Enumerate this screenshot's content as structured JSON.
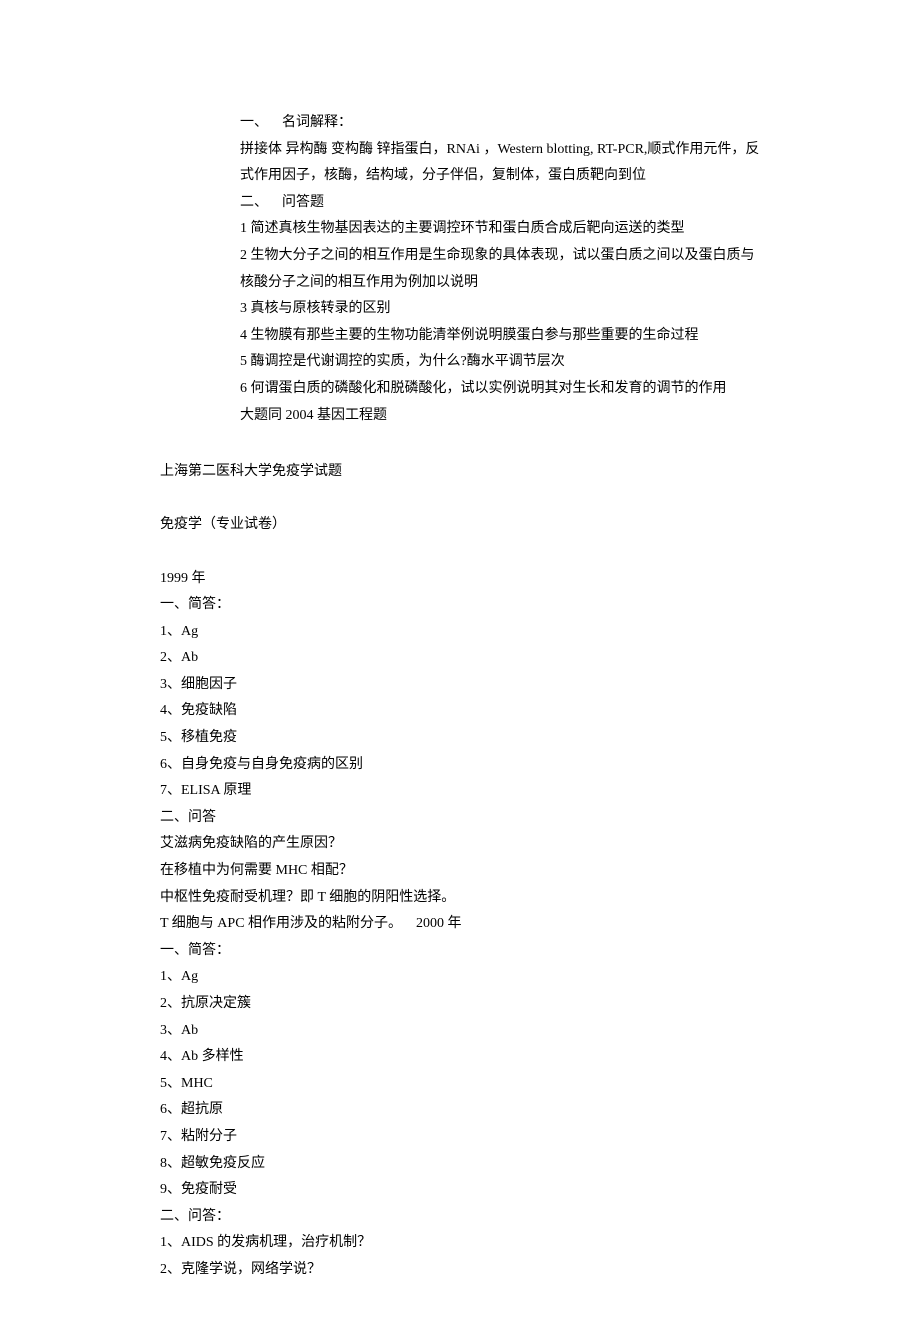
{
  "block1": {
    "s1_title": "一、 名词解释：",
    "s1_terms": "拼接体 异构酶 变构酶 锌指蛋白，RNAi ，Western blotting, RT-PCR,顺式作用元件，反式作用因子，核酶，结构域，分子伴侣，复制体，蛋白质靶向到位",
    "s2_title": "二、 问答题",
    "s2_q1": "1 简述真核生物基因表达的主要调控环节和蛋白质合成后靶向运送的类型",
    "s2_q2": "2 生物大分子之间的相互作用是生命现象的具体表现，试以蛋白质之间以及蛋白质与核酸分子之间的相互作用为例加以说明",
    "s2_q3": "3 真核与原核转录的区别",
    "s2_q4": "4 生物膜有那些主要的生物功能清举例说明膜蛋白参与那些重要的生命过程",
    "s2_q5": "5 酶调控是代谢调控的实质，为什么?酶水平调节层次",
    "s2_q6": "6 何谓蛋白质的磷酸化和脱磷酸化，试以实例说明其对生长和发育的调节的作用",
    "s2_note": "大题同 2004 基因工程题"
  },
  "block2": {
    "title": "上海第二医科大学免疫学试题",
    "subtitle": "免疫学（专业试卷）",
    "y1999": {
      "year": "1999 年",
      "s1_title": "一、简答：",
      "s1_items": [
        "1、Ag",
        "2、Ab",
        "3、细胞因子",
        "4、免疫缺陷",
        "5、移植免疫",
        "6、自身免疫与自身免疫病的区别",
        "7、ELISA 原理"
      ],
      "s2_title": "二、问答",
      "s2_items": [
        "艾滋病免疫缺陷的产生原因？",
        "在移植中为何需要 MHC 相配？",
        "中枢性免疫耐受机理？即 T 细胞的阴阳性选择。",
        "T 细胞与 APC 相作用涉及的粘附分子。 2000 年"
      ]
    },
    "y2000": {
      "s1_title": "一、简答：",
      "s1_items": [
        "1、Ag",
        "2、抗原决定簇",
        "3、Ab",
        "4、Ab 多样性",
        "5、MHC",
        "6、超抗原",
        "7、粘附分子",
        "8、超敏免疫反应",
        "9、免疫耐受"
      ],
      "s2_title": "二、问答：",
      "s2_items": [
        "1、AIDS 的发病机理，治疗机制？",
        "2、克隆学说，网络学说？"
      ]
    }
  }
}
